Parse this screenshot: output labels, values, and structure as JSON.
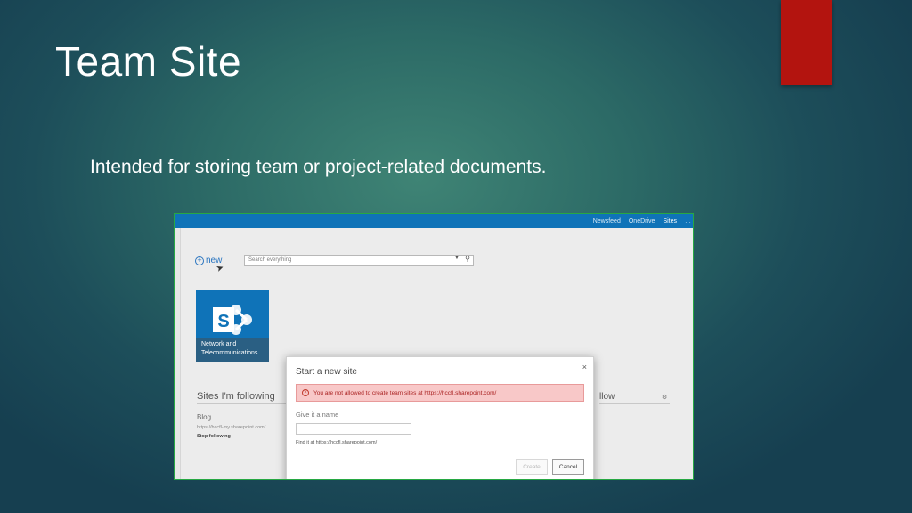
{
  "slide": {
    "title": "Team Site",
    "bullet": "Intended for storing team or project-related documents.",
    "accent_color": "#b3140f"
  },
  "suite_bar": {
    "links": [
      "Newsfeed",
      "OneDrive",
      "Sites"
    ],
    "more": "…",
    "color": "#0f73b8"
  },
  "toolbar": {
    "new_label": "new",
    "search_placeholder": "Search everything"
  },
  "tile": {
    "label_line1": "Network and",
    "label_line2": "Telecommunications"
  },
  "following": {
    "title": "Sites I'm following",
    "blog_name": "Blog",
    "blog_url": "https://hccfl-my.sharepoint.com/",
    "stop_label": "Stop following"
  },
  "suggested": {
    "title_fragment": "llow"
  },
  "dialog": {
    "title": "Start a new site",
    "close": "×",
    "error": "You are not allowed to create team sites at https://hccfl.sharepoint.com/",
    "name_label": "Give it a name",
    "find_label": "Find it at  https://hccfl.sharepoint.com/",
    "create_label": "Create",
    "cancel_label": "Cancel"
  }
}
